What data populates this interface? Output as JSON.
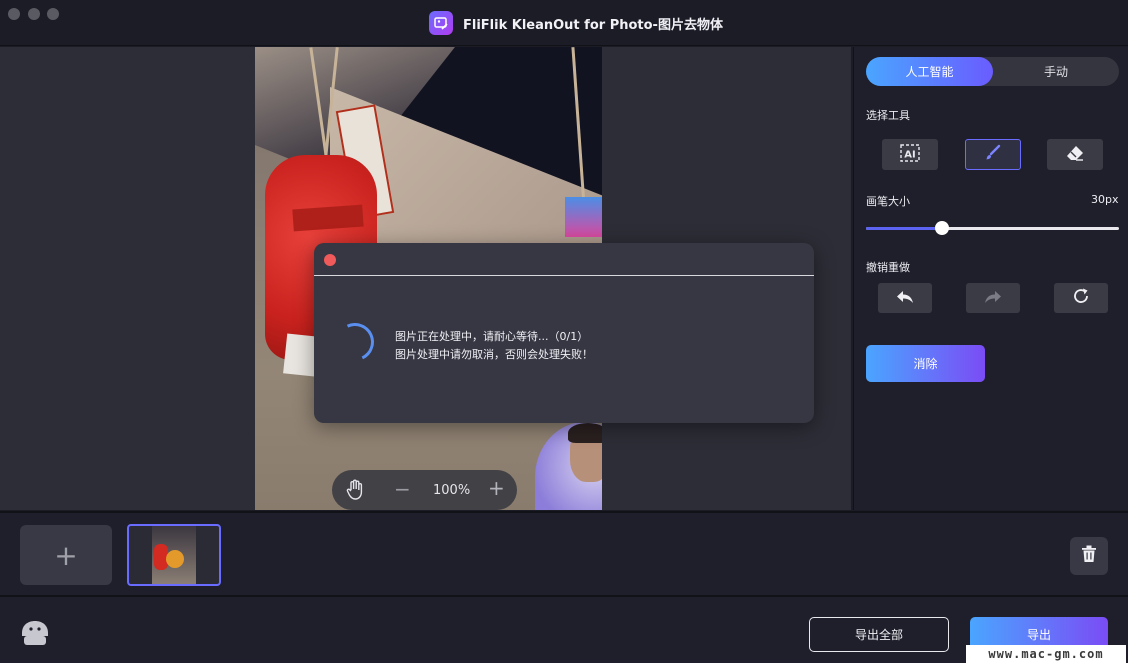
{
  "window": {
    "title": "FliFlik KleanOut for Photo-图片去物体",
    "traffic_lights": [
      "close",
      "minimize",
      "zoom"
    ]
  },
  "canvas": {
    "zoom_label": "100%",
    "icons": {
      "hand": "hand-pan-icon",
      "zoom_out": "minus-icon",
      "zoom_in": "plus-icon"
    }
  },
  "dialog": {
    "line1": "图片正在处理中，请耐心等待...（0/1）",
    "line2": "图片处理中请勿取消，否则会处理失败！",
    "progress_current": 0,
    "progress_total": 1
  },
  "panel": {
    "modes": [
      {
        "label": "人工智能",
        "active": true
      },
      {
        "label": "手动",
        "active": false
      }
    ],
    "select_tool_label": "选择工具",
    "tools": [
      {
        "icon": "ai-select-icon",
        "active": false
      },
      {
        "icon": "brush-icon",
        "active": true
      },
      {
        "icon": "eraser-icon",
        "active": false
      }
    ],
    "brush_size_label": "画笔大小",
    "brush_size_value": "30px",
    "brush_slider_fraction": 0.3,
    "undo_redo_label": "撤销重做",
    "history": [
      {
        "icon": "undo-icon",
        "enabled": true
      },
      {
        "icon": "redo-icon",
        "enabled": false
      },
      {
        "icon": "reset-icon",
        "enabled": true
      }
    ],
    "erase_label": "消除"
  },
  "strip": {
    "add_icon": "plus-icon",
    "delete_icon": "trash-icon"
  },
  "footer": {
    "export_all_label": "导出全部",
    "export_label": "导出",
    "feedback_icon": "feedback-icon",
    "watermark": "www.mac-gm.com"
  },
  "colors": {
    "accent_start": "#4aa5ff",
    "accent_end": "#7b4cf5",
    "close_red": "#f05a5a",
    "background": "#1b1c26"
  }
}
